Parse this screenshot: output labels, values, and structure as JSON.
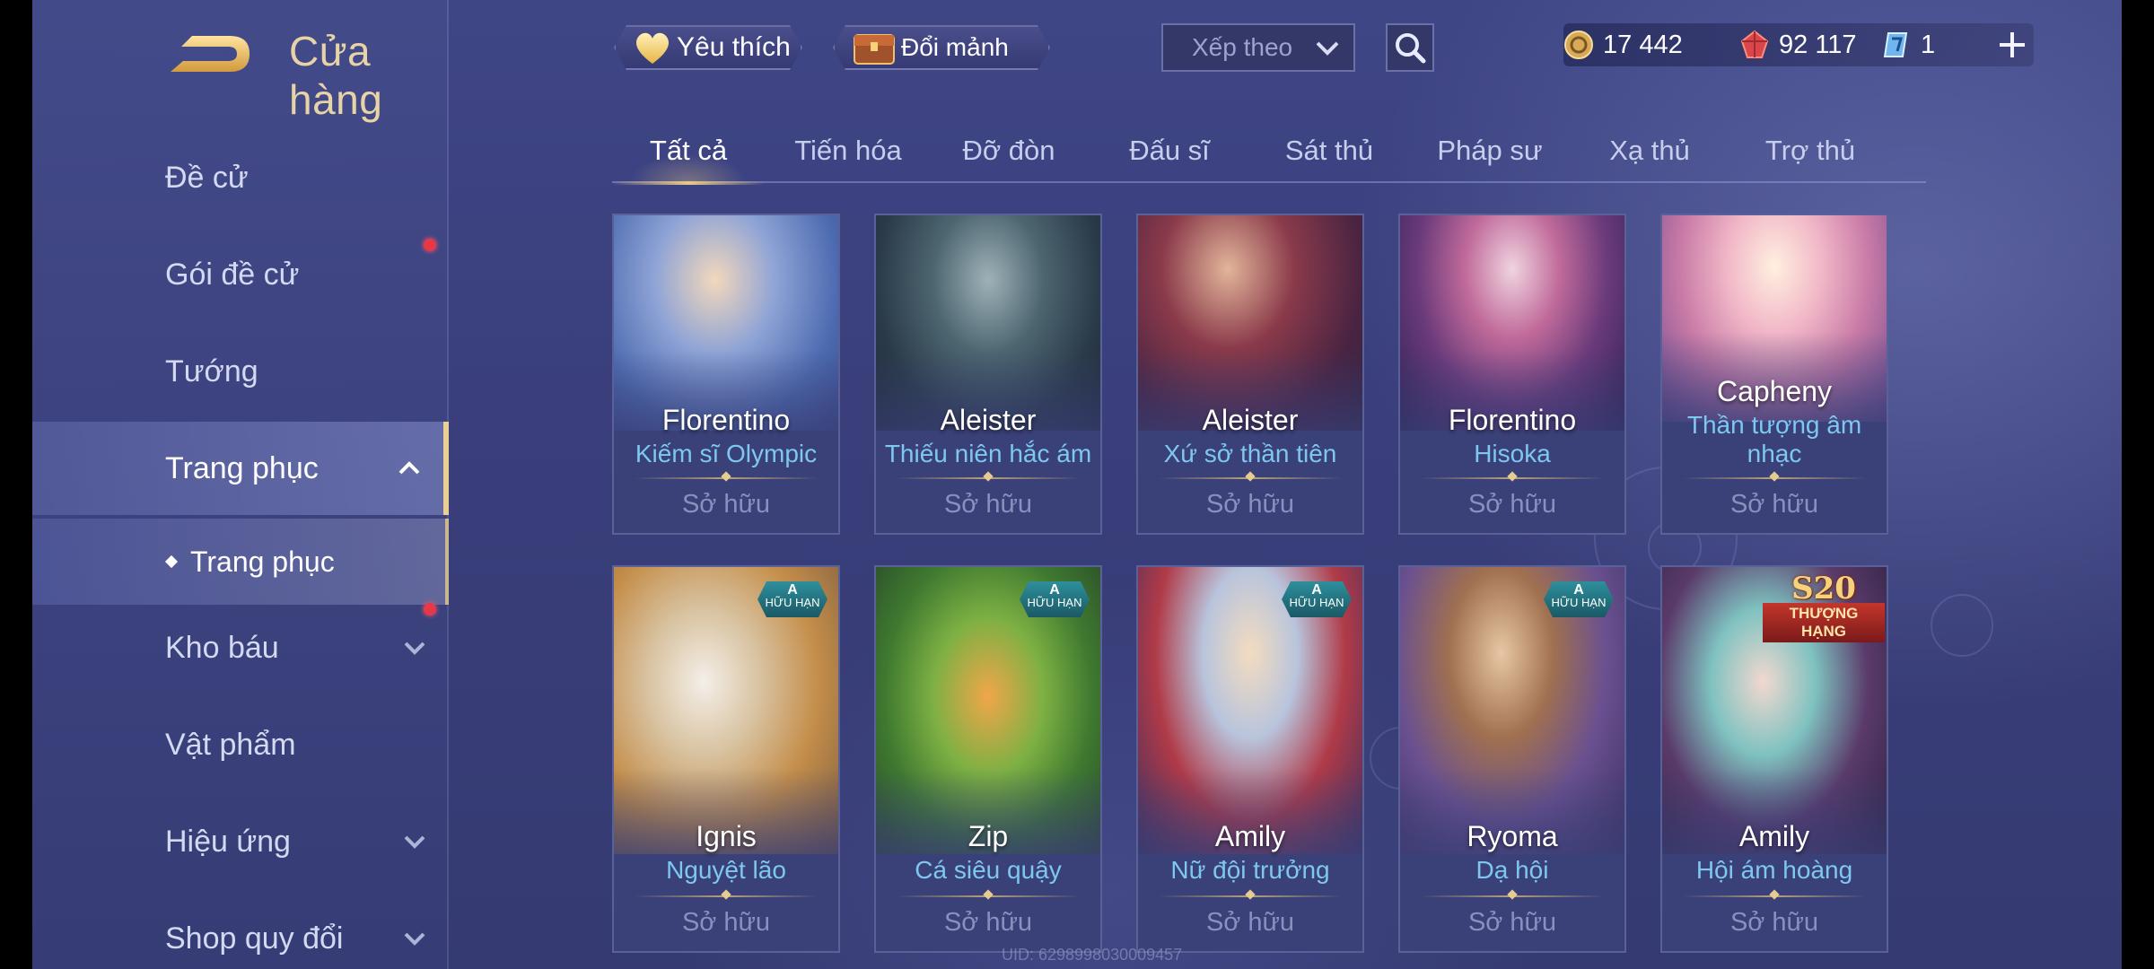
{
  "header": {
    "title": "Cửa hàng"
  },
  "sidebar": {
    "items": [
      {
        "label": "Đề cử"
      },
      {
        "label": "Gói đề cử"
      },
      {
        "label": "Tướng"
      },
      {
        "label": "Trang phục"
      },
      {
        "label": "Trang phục"
      },
      {
        "label": "Kho báu"
      },
      {
        "label": "Vật phẩm"
      },
      {
        "label": "Hiệu ứng"
      },
      {
        "label": "Shop quy đổi"
      }
    ]
  },
  "topbar": {
    "favorites_label": "Yêu thích",
    "exchange_label": "Đổi mảnh",
    "sort_label": "Xếp theo"
  },
  "currency": {
    "gold": "17 442",
    "vouchers": "92 117",
    "gems": "1"
  },
  "tabs": [
    "Tất cả",
    "Tiến hóa",
    "Đỡ đòn",
    "Đấu sĩ",
    "Sát thủ",
    "Pháp sư",
    "Xạ thủ",
    "Trợ thủ"
  ],
  "cards": [
    {
      "hero": "Florentino",
      "skin": "Kiếm sĩ Olympic",
      "status": "Sở hữu"
    },
    {
      "hero": "Aleister",
      "skin": "Thiếu niên hắc ám",
      "status": "Sở hữu"
    },
    {
      "hero": "Aleister",
      "skin": "Xứ sở thần tiên",
      "status": "Sở hữu"
    },
    {
      "hero": "Florentino",
      "skin": "Hisoka",
      "status": "Sở hữu"
    },
    {
      "hero": "Capheny",
      "skin": "Thần tượng âm nhạc",
      "status": "Sở hữu"
    },
    {
      "hero": "Ignis",
      "skin": "Nguyệt lão",
      "status": "Sở hữu",
      "badge": "A",
      "badge_text": "HỮU HẠN"
    },
    {
      "hero": "Zip",
      "skin": "Cá siêu quậy",
      "status": "Sở hữu",
      "badge": "A",
      "badge_text": "HỮU HẠN"
    },
    {
      "hero": "Amily",
      "skin": "Nữ đội trưởng",
      "status": "Sở hữu",
      "badge": "A",
      "badge_text": "HỮU HẠN"
    },
    {
      "hero": "Ryoma",
      "skin": "Dạ hội",
      "status": "Sở hữu",
      "badge": "A",
      "badge_text": "HỮU HẠN"
    },
    {
      "hero": "Amily",
      "skin": "Hội ám hoàng",
      "status": "Sở hữu",
      "badge": "S20",
      "badge_text": "THƯỢNG HẠNG"
    }
  ],
  "uid": "UID: 6298998030009457",
  "colors": {
    "accent_gold": "#e8c987",
    "skin_name": "#7ec7f0",
    "notify": "#e53848"
  }
}
